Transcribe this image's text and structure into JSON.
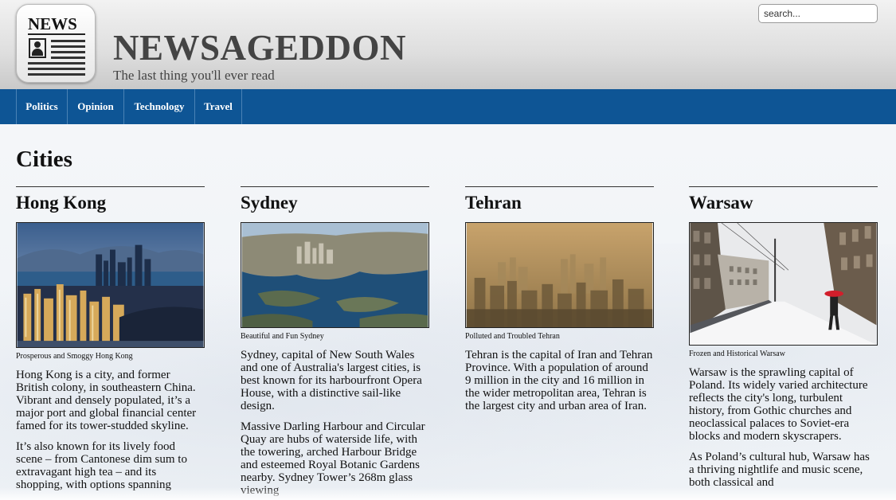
{
  "header": {
    "logo_text": "NEWS",
    "site_title": "NEWSAGEDDON",
    "tagline": "The last thing you'll ever read",
    "search_placeholder": "search..."
  },
  "nav": {
    "items": [
      {
        "label": "Politics"
      },
      {
        "label": "Opinion"
      },
      {
        "label": "Technology"
      },
      {
        "label": "Travel"
      }
    ]
  },
  "main": {
    "heading": "Cities",
    "cities": [
      {
        "name": "Hong Kong",
        "caption": "Prosperous and Smoggy Hong Kong",
        "paragraphs": [
          "Hong Kong is a city, and former British colony, in southeastern China. Vibrant and densely populated, it’s a major port and global financial center famed for its tower-studded skyline.",
          "It’s also known for its lively food scene – from Cantonese dim sum to extravagant high tea – and its shopping, with options spanning"
        ]
      },
      {
        "name": "Sydney",
        "caption": "Beautiful and Fun Sydney",
        "paragraphs": [
          "Sydney, capital of New South Wales and one of Australia's largest cities, is best known for its harbourfront Opera House, with a distinctive sail-like design.",
          "Massive Darling Harbour and Circular Quay are hubs of waterside life, with the towering, arched Harbour Bridge and esteemed Royal Botanic Gardens nearby. Sydney Tower’s 268m glass viewing"
        ]
      },
      {
        "name": "Tehran",
        "caption": "Polluted and Troubled Tehran",
        "paragraphs": [
          "Tehran is the capital of Iran and Tehran Province. With a population of around 9 million in the city and 16 million in the wider metropolitan area, Tehran is the largest city and urban area of Iran."
        ]
      },
      {
        "name": "Warsaw",
        "caption": "Frozen and Historical Warsaw",
        "paragraphs": [
          "Warsaw is the sprawling capital of Poland. Its widely varied architecture reflects the city's long, turbulent history, from Gothic churches and neoclassical palaces to Soviet-era blocks and modern skyscrapers.",
          "As Poland’s cultural hub, Warsaw has a thriving nightlife and music scene, both classical and"
        ]
      }
    ]
  }
}
